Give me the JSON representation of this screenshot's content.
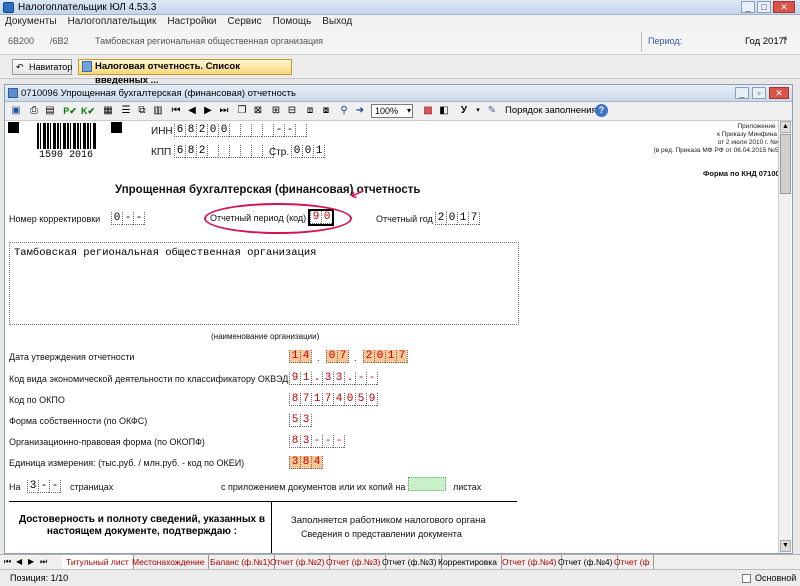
{
  "window": {
    "title": "Налогоплательщик ЮЛ 4.53.3",
    "minimize": "_",
    "maximize": "□",
    "close": "✕"
  },
  "menu": [
    "Документы",
    "Налогоплательщик",
    "Настройки",
    "Сервис",
    "Помощь",
    "Выход"
  ],
  "info": {
    "code1": "6В200",
    "code2": "/6В2",
    "org": "Тамбовская региональная общественная организация",
    "period_label": "Период:",
    "period_value": "Год 2017г"
  },
  "nav": {
    "navigator": "Навигатор",
    "active_tab": "Налоговая отчетность. Список введенных ..."
  },
  "inner": {
    "title": "0710096 Упрощенная бухгалтерская (финансовая) отчетность",
    "zoom": "100%",
    "fill_order": "Порядок заполнения"
  },
  "form": {
    "barcode_number": "1590  2016",
    "inn_label": "ИНН",
    "inn": [
      "6",
      "8",
      "2",
      "0",
      "0",
      " ",
      " ",
      " ",
      " ",
      "-",
      "-",
      " "
    ],
    "kpp_label": "КПП",
    "kpp": [
      "6",
      "8",
      "2",
      " ",
      " ",
      " ",
      " ",
      " ",
      " "
    ],
    "page_label": "Стр.",
    "page": [
      "0",
      "0",
      "1"
    ],
    "appendix": [
      "Приложение №5",
      "к Приказу Минфина РФ",
      "от 2 июля 2010 г. №66н",
      "(в ред. Приказа МФ РФ от 06.04.2015 №57н)"
    ],
    "knd": "Форма по КНД 0710096",
    "title": "Упрощенная бухгалтерская (финансовая) отчетность",
    "corr_label": "Номер корректировки",
    "corr": [
      "0",
      "-",
      "-"
    ],
    "period_label": "Отчетный период (код)",
    "period": [
      "9",
      "0"
    ],
    "year_label": "Отчетный год",
    "year": [
      "2",
      "0",
      "1",
      "7"
    ],
    "org_name": "Тамбовская региональная общественная организация",
    "org_caption": "(наименование организации)",
    "approve_label": "Дата утверждения отчетности",
    "approve_d": [
      "1",
      "4"
    ],
    "approve_m": [
      "0",
      "7"
    ],
    "approve_y": [
      "2",
      "0",
      "1",
      "7"
    ],
    "okved_label": "Код вида экономической деятельности по классификатору ОКВЭД",
    "okved": [
      "9",
      "1",
      ".",
      "3",
      "3",
      ".",
      "-",
      "-"
    ],
    "okpo_label": "Код по ОКПО",
    "okpo": [
      "8",
      "7",
      "1",
      "7",
      "4",
      "0",
      "5",
      "9"
    ],
    "okfs_label": "Форма собственности (по ОКФС)",
    "okfs": [
      "5",
      "3"
    ],
    "okopf_label": "Организационно-правовая форма (по ОКОПФ)",
    "okopf": [
      "8",
      "3",
      "-",
      "-",
      "-"
    ],
    "okei_label": "Единица измерения: (тыс.руб. / млн.руб. - код по ОКЕИ)",
    "okei": [
      "3",
      "8",
      "4"
    ],
    "on_label": "На",
    "pages": [
      "3",
      "-",
      "-"
    ],
    "pages_label": "страницах",
    "attach_label": "с приложением документов или их копий на",
    "sheets_label": "листах",
    "trust_title": "Достоверность и полноту сведений, указанных в настоящем документе, подтверждаю :",
    "tax_title": "Заполняется работником налогового органа",
    "tax_sub": "Сведения о представлении документа"
  },
  "tabs": [
    "Титульный лист",
    "Местонахождение",
    "Баланс (ф.№1)",
    "Отчет (ф.№2)",
    "Отчет (ф.№3)",
    "Отчет (ф.№3)",
    "Корректировка",
    "Отчет (ф.№4)",
    "Отчет (ф.№4)",
    "Отчет (ф"
  ],
  "status": {
    "position": "Позиция: 1/10",
    "mode": "Основной"
  },
  "colors": {
    "accent_red": "#c00000",
    "fill_orange": "#f9c796",
    "annotation": "#d4145a"
  }
}
